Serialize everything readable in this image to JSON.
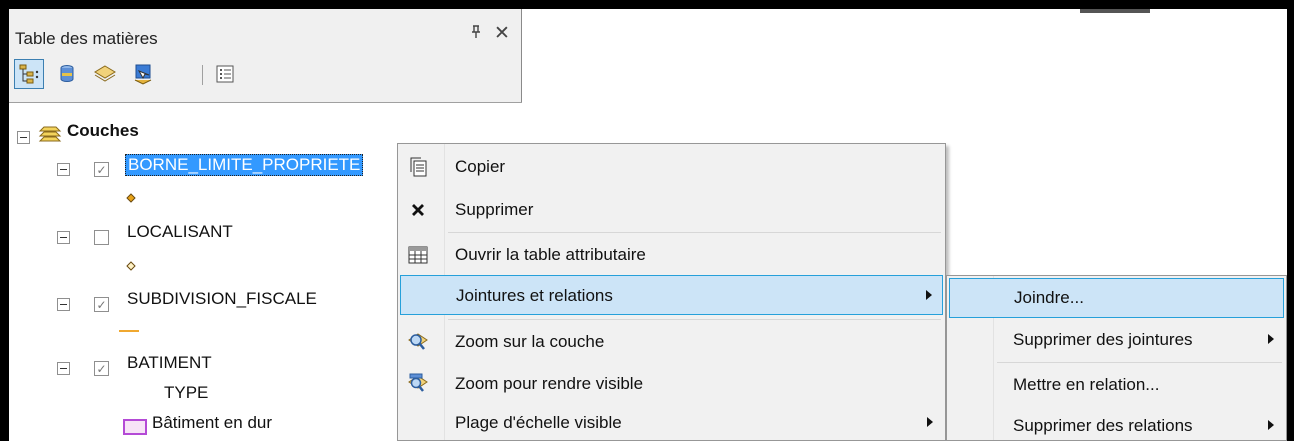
{
  "toc": {
    "title": "Table des matières",
    "pin_glyph": "ᵖ",
    "close_glyph": "✕",
    "toolbar": [
      {
        "icon": "list-by-drawing-order-icon",
        "active": true
      },
      {
        "icon": "list-by-source-icon"
      },
      {
        "icon": "list-by-visibility-icon"
      },
      {
        "icon": "list-by-selection-icon"
      },
      {
        "icon": "options-icon"
      }
    ],
    "tree": {
      "root": "Couches",
      "layers": [
        {
          "name": "BORNE_LIMITE_PROPRIETE",
          "checked": true,
          "selected": true,
          "symbol": "orange-diamond"
        },
        {
          "name": "LOCALISANT",
          "checked": false,
          "symbol": "hollow-diamond"
        },
        {
          "name": "SUBDIVISION_FISCALE",
          "checked": true,
          "symbol": "orange-line"
        },
        {
          "name": "BATIMENT",
          "checked": true,
          "field": "TYPE",
          "legend_item": "Bâtiment en dur"
        }
      ]
    }
  },
  "context_menu": {
    "items": [
      {
        "icon": "copy-icon",
        "label": "Copier"
      },
      {
        "icon": "delete-icon",
        "label": "Supprimer"
      },
      {
        "icon": "attribute-table-icon",
        "label": "Ouvrir la table attributaire"
      },
      {
        "label": "Jointures et relations",
        "has_submenu": true,
        "highlighted": true
      },
      {
        "icon": "zoom-to-layer-icon",
        "label": "Zoom sur la couche"
      },
      {
        "icon": "zoom-to-visible-icon",
        "label": "Zoom pour rendre visible"
      },
      {
        "label": "Plage d'échelle visible",
        "has_submenu": true
      }
    ]
  },
  "submenu": {
    "items": [
      {
        "label": "Joindre...",
        "highlighted": true
      },
      {
        "label": "Supprimer des jointures",
        "has_submenu": true
      },
      {
        "label": "Mettre en relation..."
      },
      {
        "label": "Supprimer des relations",
        "has_submenu": true
      }
    ]
  }
}
